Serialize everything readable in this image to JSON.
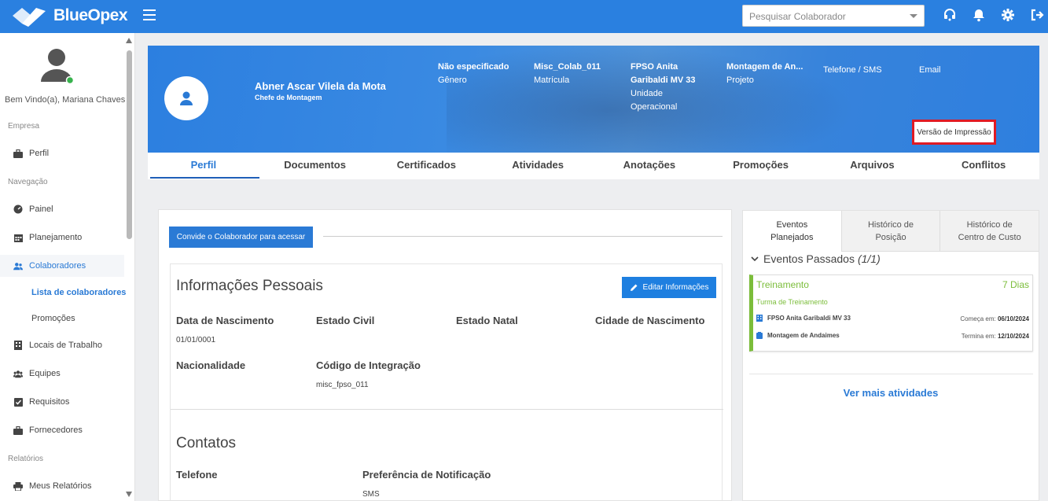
{
  "app": {
    "name": "BlueOpex",
    "search_placeholder": "Pesquisar Colaborador"
  },
  "colors": {
    "primary": "#2a80e0",
    "accent_green": "#7bbd3a",
    "highlight_red": "#e01b24"
  },
  "topbar_icons": [
    "menu-icon",
    "headset-icon",
    "bell-icon",
    "gear-icon",
    "logout-icon"
  ],
  "sidebar": {
    "welcome": "Bem Vindo(a), Mariana Chaves",
    "sections": {
      "empresa": "Empresa",
      "navegacao": "Navegação",
      "relatorios": "Relatórios"
    },
    "items": {
      "perfil": "Perfil",
      "painel": "Painel",
      "planejamento": "Planejamento",
      "colaboradores": "Colaboradores",
      "lista": "Lista de colaboradores",
      "promocoes": "Promoções",
      "locais": "Locais de Trabalho",
      "equipes": "Equipes",
      "requisitos": "Requisitos",
      "fornecedores": "Fornecedores",
      "meus_relatorios": "Meus Relatórios"
    }
  },
  "profile": {
    "name": "Abner Ascar Vilela da Mota",
    "role": "Chefe de Montagem",
    "genero_value": "Não especificado",
    "genero_label": "Gênero",
    "matricula_value": "Misc_Colab_011",
    "matricula_label": "Matrícula",
    "unidade_value_1": "FPSO Anita",
    "unidade_value_2": "Garibaldi MV 33",
    "unidade_label_1": "Unidade",
    "unidade_label_2": "Operacional",
    "projeto_value": "Montagem de An...",
    "projeto_label": "Projeto",
    "telefone_label": "Telefone / SMS",
    "email_label": "Email",
    "print_button": "Versão de Impressão"
  },
  "tabs": [
    "Perfil",
    "Documentos",
    "Certificados",
    "Atividades",
    "Anotações",
    "Promoções",
    "Arquivos",
    "Conflitos"
  ],
  "main": {
    "invite_button": "Convide o Colaborador para acessar",
    "personal_title": "Informações Pessoais",
    "edit_button": "Editar Informações",
    "fields": {
      "nascimento_label": "Data de Nascimento",
      "nascimento_value": "01/01/0001",
      "estado_civil_label": "Estado Civil",
      "estado_natal_label": "Estado Natal",
      "cidade_label": "Cidade de Nascimento",
      "nacionalidade_label": "Nacionalidade",
      "integracao_label": "Código de Integração",
      "integracao_value": "misc_fpso_011"
    },
    "contacts_title": "Contatos",
    "contacts": {
      "telefone_label": "Telefone",
      "preferencia_label": "Preferência de Notificação",
      "preferencia_value": "SMS"
    }
  },
  "right_panel": {
    "tabs": [
      {
        "line1": "Eventos",
        "line2": "Planejados"
      },
      {
        "line1": "Histórico de",
        "line2": "Posição"
      },
      {
        "line1": "Histórico de",
        "line2": "Centro de Custo"
      }
    ],
    "events_title": "Eventos Passados",
    "events_count": "(1/1)",
    "event": {
      "title": "Treinamento",
      "days": "7 Dias",
      "subtitle": "Turma de Treinamento",
      "location": "FPSO Anita Garibaldi MV 33",
      "start_label": "Começa em:",
      "start_date": "06/10/2024",
      "project": "Montagem de Andaimes",
      "end_label": "Termina em:",
      "end_date": "12/10/2024"
    },
    "more_link": "Ver mais atividades"
  }
}
